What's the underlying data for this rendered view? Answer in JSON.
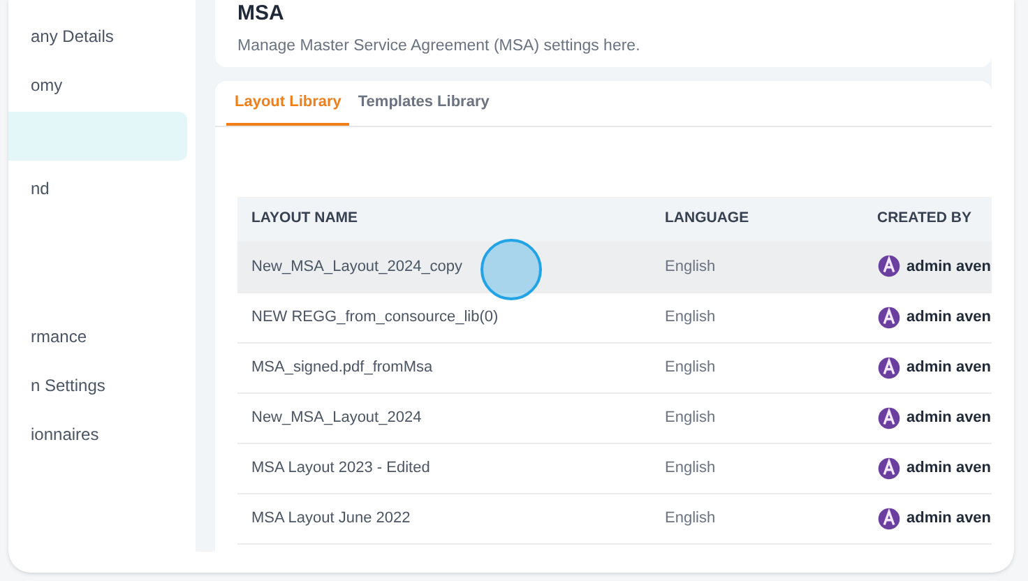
{
  "sidebar": {
    "items": [
      {
        "label": "any Details",
        "selected": false
      },
      {
        "label": "omy",
        "selected": false
      },
      {
        "selected": true
      },
      {
        "label": "nd",
        "selected": false
      },
      {
        "label": "rmance",
        "selected": false
      },
      {
        "label": "n Settings",
        "selected": false
      },
      {
        "label": "ionnaires",
        "selected": false
      }
    ]
  },
  "header": {
    "title": "MSA",
    "subtitle": "Manage Master Service Agreement (MSA) settings here."
  },
  "tabs": [
    {
      "label": "Layout Library",
      "selected": true
    },
    {
      "label": "Templates Library",
      "selected": false
    }
  ],
  "table": {
    "columns": [
      "LAYOUT NAME",
      "LANGUAGE",
      "CREATED BY"
    ],
    "rows": [
      {
        "name": "New_MSA_Layout_2024_copy",
        "language": "English",
        "created_by": "admin aven",
        "highlighted": true
      },
      {
        "name": "NEW REGG_from_consource_lib(0)",
        "language": "English",
        "created_by": "admin aven",
        "highlighted": false
      },
      {
        "name": "MSA_signed.pdf_fromMsa",
        "language": "English",
        "created_by": "admin aven",
        "highlighted": false
      },
      {
        "name": "New_MSA_Layout_2024",
        "language": "English",
        "created_by": "admin aven",
        "highlighted": false
      },
      {
        "name": "MSA Layout 2023 - Edited",
        "language": "English",
        "created_by": "admin aven",
        "highlighted": false
      },
      {
        "name": "MSA Layout June 2022",
        "language": "English",
        "created_by": "admin aven",
        "highlighted": false
      }
    ]
  }
}
